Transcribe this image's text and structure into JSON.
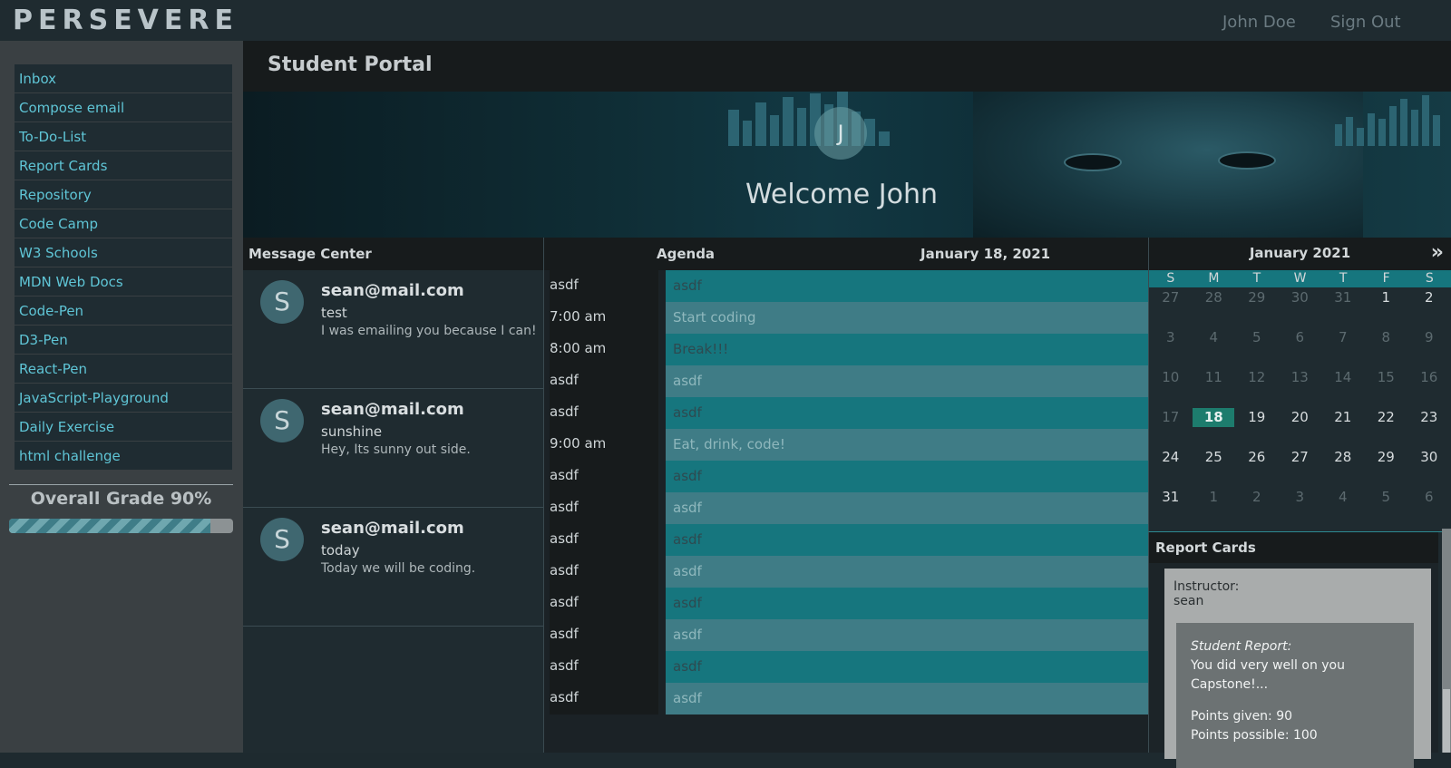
{
  "app": {
    "logo_text": "PERSEVERE"
  },
  "topnav": {
    "user": "John Doe",
    "sign_out": "Sign Out"
  },
  "sidebar": {
    "items": [
      {
        "label": "Inbox"
      },
      {
        "label": "Compose email"
      },
      {
        "label": "To-Do-List"
      },
      {
        "label": "Report Cards"
      },
      {
        "label": "Repository"
      },
      {
        "label": "Code Camp"
      },
      {
        "label": "W3 Schools"
      },
      {
        "label": "MDN Web Docs"
      },
      {
        "label": "Code-Pen"
      },
      {
        "label": "D3-Pen"
      },
      {
        "label": "React-Pen"
      },
      {
        "label": "JavaScript-Playground"
      },
      {
        "label": "Daily Exercise"
      },
      {
        "label": "html challenge"
      }
    ],
    "grade_label": "Overall Grade 90%",
    "grade_value": 0.9
  },
  "page": {
    "title": "Student Portal"
  },
  "banner": {
    "avatar_initial": "J",
    "welcome": "Welcome John"
  },
  "messages": {
    "title": "Message Center",
    "items": [
      {
        "initial": "S",
        "from": "sean@mail.com",
        "subject": "test",
        "body": "I was emailing you because I can!"
      },
      {
        "initial": "S",
        "from": "sean@mail.com",
        "subject": "sunshine",
        "body": "Hey, Its sunny out side."
      },
      {
        "initial": "S",
        "from": "sean@mail.com",
        "subject": "today",
        "body": "Today we will be coding."
      }
    ]
  },
  "agenda": {
    "title": "Agenda",
    "date": "January 18, 2021",
    "rows": [
      {
        "time": "asdf",
        "event": "asdf"
      },
      {
        "time": "7:00 am",
        "event": "Start coding"
      },
      {
        "time": "8:00 am",
        "event": "Break!!!"
      },
      {
        "time": "asdf",
        "event": "asdf"
      },
      {
        "time": "asdf",
        "event": "asdf"
      },
      {
        "time": "9:00 am",
        "event": "Eat, drink, code!"
      },
      {
        "time": "asdf",
        "event": "asdf"
      },
      {
        "time": "asdf",
        "event": "asdf"
      },
      {
        "time": "asdf",
        "event": "asdf"
      },
      {
        "time": "asdf",
        "event": "asdf"
      },
      {
        "time": "asdf",
        "event": "asdf"
      },
      {
        "time": "asdf",
        "event": "asdf"
      },
      {
        "time": "asdf",
        "event": "asdf"
      },
      {
        "time": "asdf",
        "event": "asdf"
      }
    ]
  },
  "calendar": {
    "title": "January 2021",
    "next_icon": "double-chevron-right-icon",
    "weekdays": [
      "S",
      "M",
      "T",
      "W",
      "T",
      "F",
      "S"
    ],
    "days": [
      [
        "27",
        "28",
        "29",
        "30",
        "31",
        "1",
        "2"
      ],
      [
        "3",
        "4",
        "5",
        "6",
        "7",
        "8",
        "9"
      ],
      [
        "10",
        "11",
        "12",
        "13",
        "14",
        "15",
        "16"
      ],
      [
        "17",
        "18",
        "19",
        "20",
        "21",
        "22",
        "23"
      ],
      [
        "24",
        "25",
        "26",
        "27",
        "28",
        "29",
        "30"
      ],
      [
        "31",
        "1",
        "2",
        "3",
        "4",
        "5",
        "6"
      ]
    ],
    "today": "18"
  },
  "report": {
    "title": "Report Cards",
    "instructor_label": "Instructor:",
    "instructor": "sean",
    "student_report_label": "Student Report:",
    "student_report": "You did very well on you Capstone!...",
    "points_given": "Points given: 90",
    "points_possible": "Points possible: 100"
  },
  "colors": {
    "accent": "#16767e",
    "link": "#5fc5d6",
    "today": "#1d7c6d"
  }
}
